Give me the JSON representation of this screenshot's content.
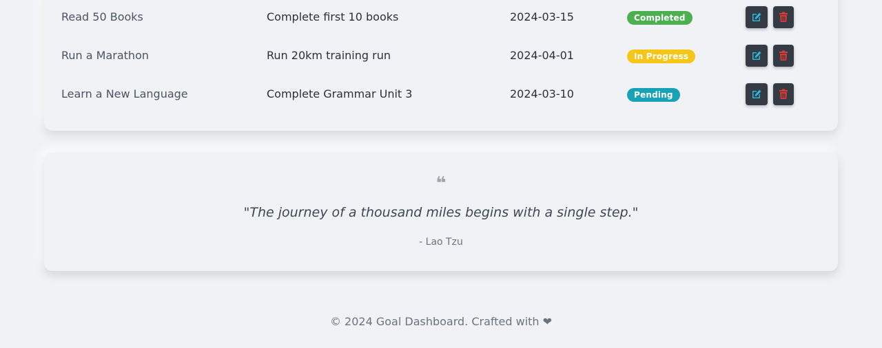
{
  "colors": {
    "completed": "#4caf50",
    "in_progress": "#f5c518",
    "pending": "#17a2b8",
    "edit_icon": "#29b6d8",
    "delete_icon": "#e53935"
  },
  "goals": [
    {
      "goal": "Read 50 Books",
      "milestone": "Complete first 10 books",
      "date": "2024-03-15",
      "status": "Completed",
      "status_key": "completed"
    },
    {
      "goal": "Run a Marathon",
      "milestone": "Run 20km training run",
      "date": "2024-04-01",
      "status": "In Progress",
      "status_key": "in_progress"
    },
    {
      "goal": "Learn a New Language",
      "milestone": "Complete Grammar Unit 3",
      "date": "2024-03-10",
      "status": "Pending",
      "status_key": "pending"
    }
  ],
  "actions": {
    "edit_icon": "edit-icon",
    "delete_icon": "trash-icon"
  },
  "quote": {
    "icon": "quote-icon",
    "mark": "❝",
    "text": "\"The journey of a thousand miles begins with a single step.\"",
    "author": "- Lao Tzu"
  },
  "footer": {
    "text": "© 2024 Goal Dashboard. Crafted with ❤"
  }
}
